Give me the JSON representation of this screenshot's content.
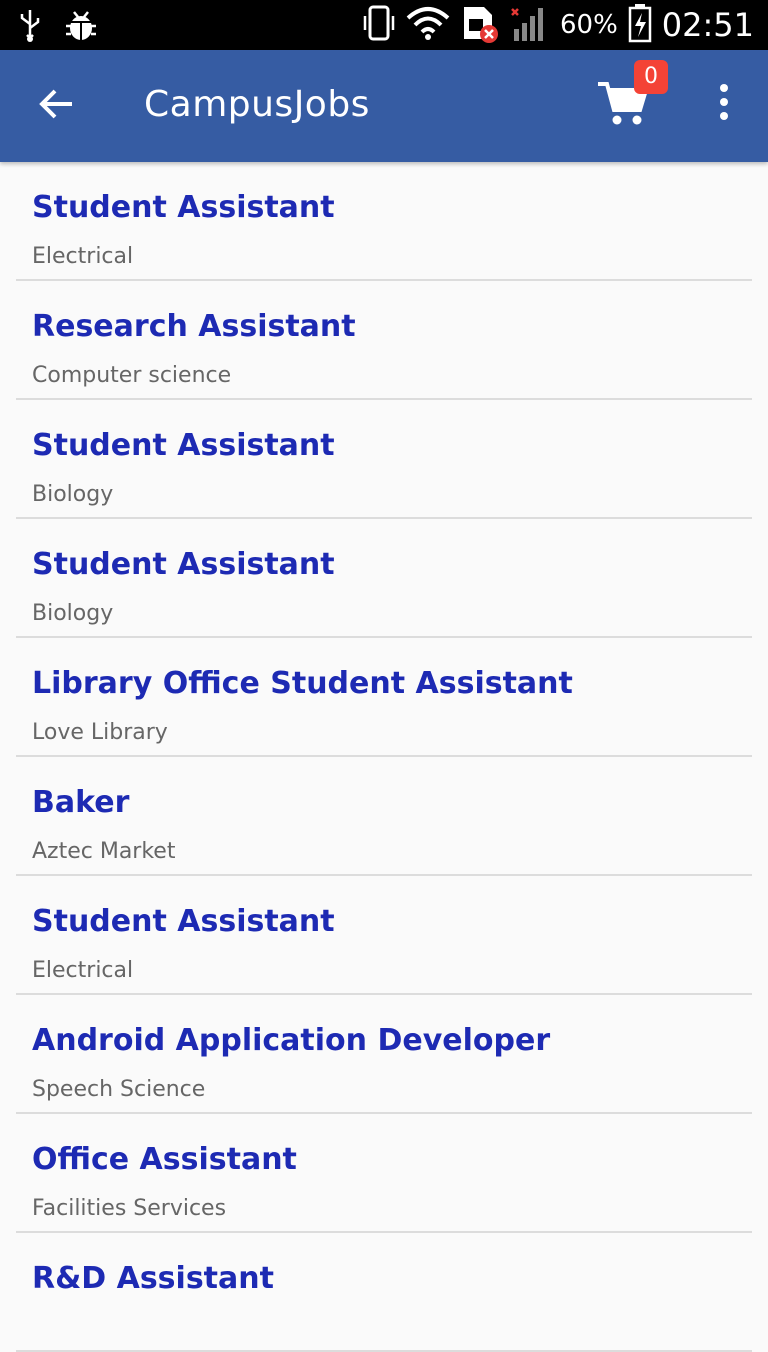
{
  "status_bar": {
    "battery": "60%",
    "time": "02:51",
    "icons": [
      "usb-icon",
      "debug-icon",
      "vibrate-icon",
      "wifi-icon",
      "sim-error-icon",
      "signal-icon",
      "battery-charging-icon"
    ]
  },
  "app_bar": {
    "title": "CampusJobs",
    "cart_count": "0",
    "icons": [
      "back-arrow-icon",
      "cart-icon",
      "overflow-menu-icon"
    ]
  },
  "jobs": [
    {
      "title": "Student Assistant",
      "department": "Electrical"
    },
    {
      "title": "Research Assistant",
      "department": "Computer science"
    },
    {
      "title": "Student Assistant",
      "department": "Biology"
    },
    {
      "title": "Student Assistant",
      "department": "Biology"
    },
    {
      "title": "Library Office Student Assistant",
      "department": "Love Library"
    },
    {
      "title": "Baker",
      "department": "Aztec Market"
    },
    {
      "title": "Student Assistant",
      "department": "Electrical"
    },
    {
      "title": "Android Application Developer",
      "department": "Speech Science"
    },
    {
      "title": "Office Assistant",
      "department": "Facilities Services"
    },
    {
      "title": "R&D Assistant",
      "department": ""
    }
  ],
  "colors": {
    "app_bar": "#365ca3",
    "job_title": "#1d2ab3",
    "badge": "#f44336"
  }
}
